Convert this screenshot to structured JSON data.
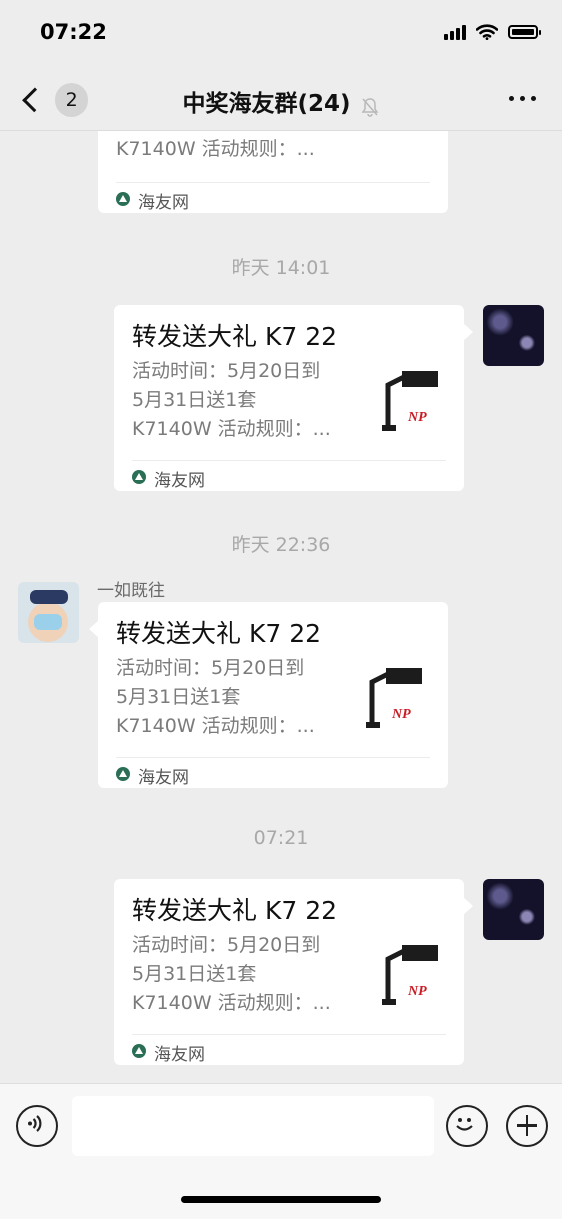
{
  "status_bar": {
    "time": "07:22"
  },
  "nav": {
    "back_badge": "2",
    "title": "中奖海友群(24)"
  },
  "partial_card": {
    "desc_line": "K7140W 活动规则：...",
    "source": "海友网"
  },
  "messages": [
    {
      "timestamp": "昨天 14:01",
      "title": "转发送大礼 K7 22",
      "desc": [
        "活动时间：5月20日到",
        "5月31日送1套",
        "K7140W 活动规则：..."
      ],
      "source": "海友网"
    },
    {
      "timestamp": "昨天 22:36",
      "sender": "一如既往",
      "title": "转发送大礼 K7 22",
      "desc": [
        "活动时间：5月20日到",
        "5月31日送1套",
        "K7140W 活动规则：..."
      ],
      "source": "海友网"
    },
    {
      "timestamp": "07:21",
      "title": "转发送大礼 K7 22",
      "desc": [
        "活动时间：5月20日到",
        "5月31日送1套",
        "K7140W 活动规则：..."
      ],
      "source": "海友网"
    }
  ],
  "thumb_text": "NP",
  "input": {
    "placeholder": ""
  }
}
